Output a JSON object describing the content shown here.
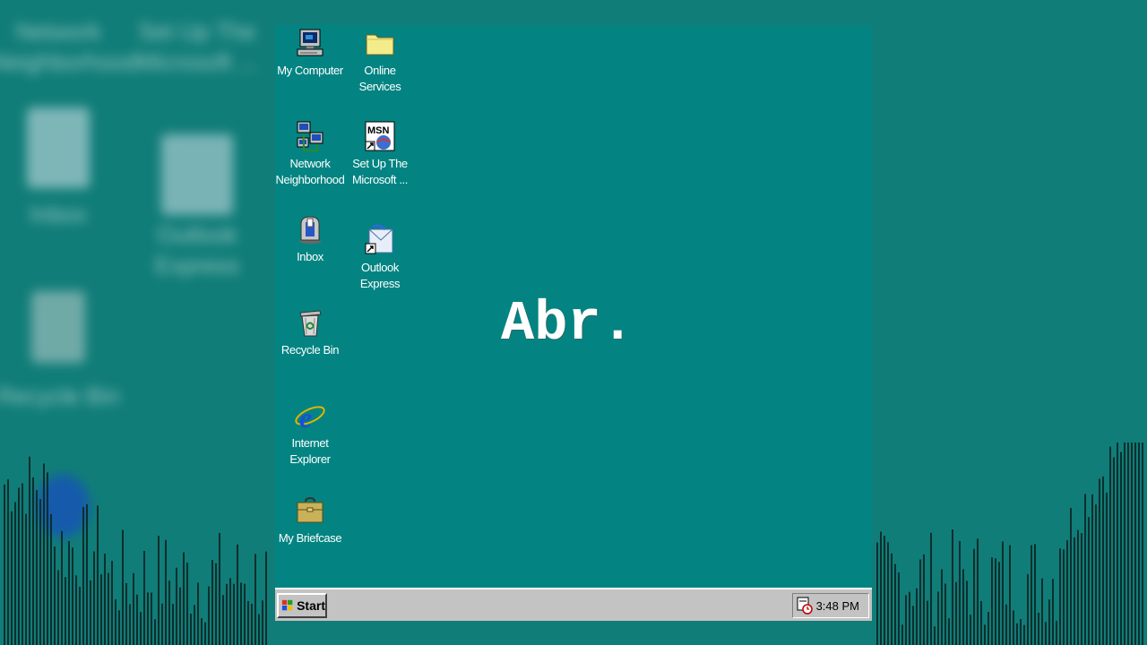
{
  "background_ghost_labels": [
    "Network\nNeighborhood",
    "Set Up The\nMicrosoft ...",
    "Inbox",
    "Outlook\nExpress",
    "Recycle Bin"
  ],
  "desktop": {
    "icons": [
      {
        "label": "My Computer",
        "icon": "my-computer-icon"
      },
      {
        "label": "Online Services",
        "icon": "folder-icon"
      },
      {
        "label": "Network Neighborhood",
        "icon": "network-neighborhood-icon"
      },
      {
        "label": "Set Up The Microsoft ...",
        "icon": "msn-setup-icon"
      },
      {
        "label": "Inbox",
        "icon": "inbox-icon"
      },
      {
        "label": "Outlook Express",
        "icon": "outlook-express-icon"
      },
      {
        "label": "Recycle Bin",
        "icon": "recycle-bin-icon"
      },
      {
        "label": "Internet Explorer",
        "icon": "internet-explorer-icon"
      },
      {
        "label": "My Briefcase",
        "icon": "briefcase-icon"
      }
    ]
  },
  "overlay_text": "Abr.",
  "taskbar": {
    "start_label": "Start",
    "clock": "3:48 PM"
  },
  "colors": {
    "desktop": "#038482",
    "taskbar": "#c3c3c3",
    "outer_background": "#117d78"
  }
}
